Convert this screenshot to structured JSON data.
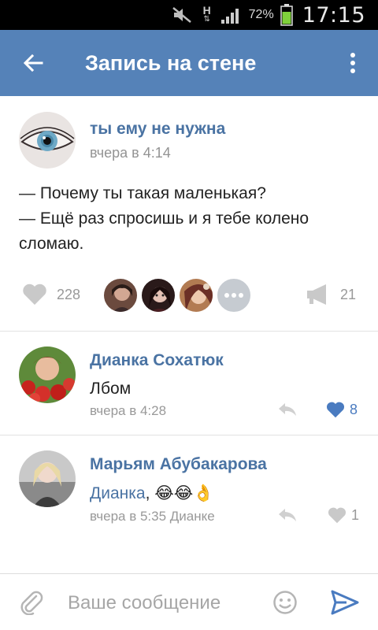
{
  "status_bar": {
    "network_letter": "H",
    "battery_percent": "72%",
    "time": "17:15"
  },
  "toolbar": {
    "title": "Запись на стене",
    "back_icon": "arrow-back-icon",
    "more_icon": "more-vertical-icon",
    "background": "#5582b8"
  },
  "post": {
    "author": "ты ему не нужна",
    "date": "вчера в 4:14",
    "text_lines": [
      "— Почему ты такая маленькая?",
      "— Ещё раз спросишь и я тебе колено",
      "сломаю."
    ],
    "likes": "228",
    "shares": "21"
  },
  "comments": [
    {
      "author": "Дианка Сохатюк",
      "text": "Лбом",
      "date": "вчера в 4:28",
      "likes": "8",
      "liked": true
    },
    {
      "author": "Марьям Абубакарова",
      "mention": "Дианка",
      "text_rest": ", 😂😂👌",
      "date": "вчера в 5:35 Дианке",
      "likes": "1",
      "liked": false
    }
  ],
  "composer": {
    "placeholder": "Ваше сообщение"
  },
  "colors": {
    "accent": "#5582b8",
    "link": "#4a73a3",
    "liked": "#4a7bc0",
    "muted": "#999999"
  }
}
